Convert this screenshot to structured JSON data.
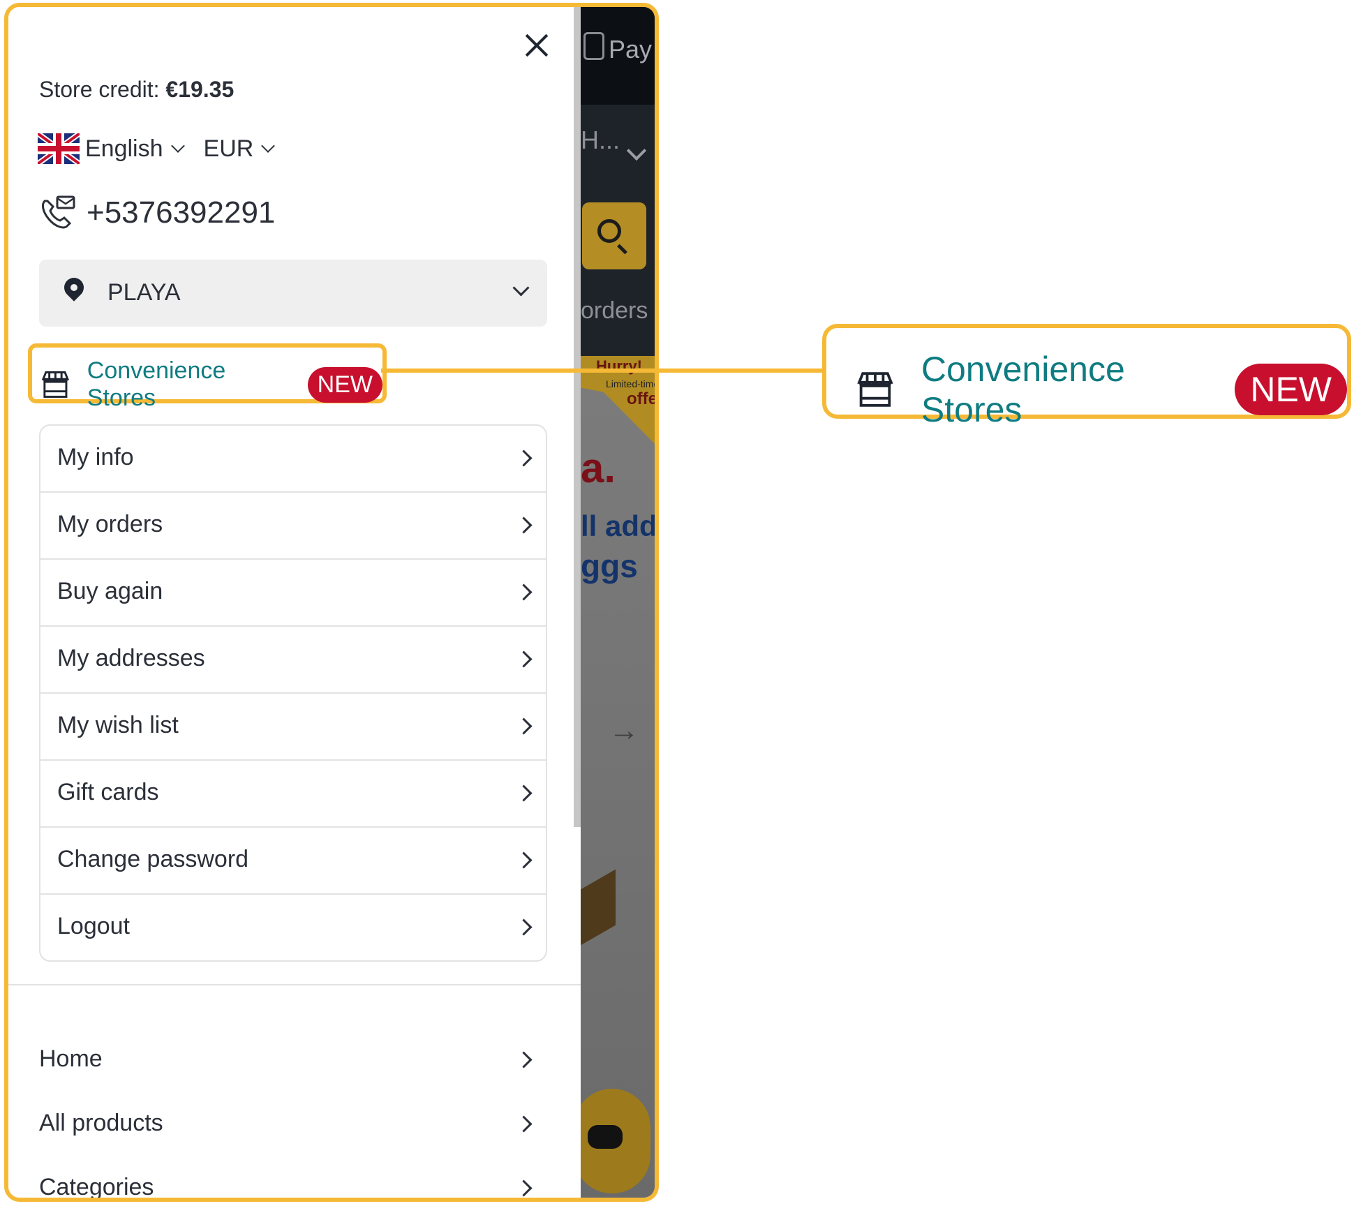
{
  "background_page": {
    "pay_label": "Pay",
    "truncated_label": "H...",
    "orders_label": "orders",
    "promo_hurry": "Hurry!",
    "promo_limited": "Limited-time",
    "promo_offer": "offer",
    "promo_letter": "a.",
    "promo_line1": "ll add",
    "promo_line2": "ggs",
    "arrow": "→"
  },
  "drawer": {
    "store_credit_label": "Store credit: ",
    "store_credit_value": "€19.35",
    "language": "English",
    "currency": "EUR",
    "phone": "+5376392291",
    "store_location": "PLAYA",
    "convenience_label": "Convenience Stores",
    "convenience_badge": "NEW",
    "account_menu": [
      {
        "label": "My info"
      },
      {
        "label": "My orders"
      },
      {
        "label": "Buy again"
      },
      {
        "label": "My addresses"
      },
      {
        "label": "My wish list"
      },
      {
        "label": "Gift cards"
      },
      {
        "label": "Change password"
      },
      {
        "label": "Logout"
      }
    ],
    "nav_menu": [
      {
        "label": "Home"
      },
      {
        "label": "All products"
      },
      {
        "label": "Categories"
      }
    ]
  },
  "callout": {
    "label": "Convenience Stores",
    "badge": "NEW"
  },
  "colors": {
    "highlight": "#f6b936",
    "accent_teal": "#0f7c82",
    "badge_red": "#c8102e"
  },
  "icons": [
    "close-icon",
    "uk-flag-icon",
    "chevron-down-icon",
    "phone-mail-icon",
    "location-pin-icon",
    "store-icon",
    "chevron-right-icon"
  ]
}
